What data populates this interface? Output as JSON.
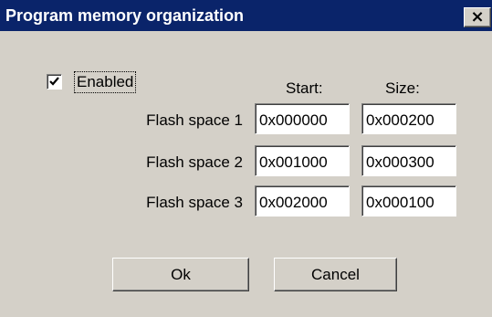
{
  "dialog": {
    "title": "Program memory organization",
    "close_glyph": "×",
    "enabled": {
      "label": "Enabled",
      "checked": true
    },
    "columns": {
      "start": "Start:",
      "size": "Size:"
    },
    "rows": [
      {
        "label": "Flash space 1",
        "start": "0x000000",
        "size": "0x000200"
      },
      {
        "label": "Flash space 2",
        "start": "0x001000",
        "size": "0x000300"
      },
      {
        "label": "Flash space 3",
        "start": "0x002000",
        "size": "0x000100"
      }
    ],
    "buttons": {
      "ok": "Ok",
      "cancel": "Cancel"
    }
  },
  "colors": {
    "titlebar": "#0a246a",
    "face": "#d4d0c8",
    "field": "#ffffff"
  },
  "icons": {
    "close": "close-icon",
    "check": "checkmark-icon"
  }
}
